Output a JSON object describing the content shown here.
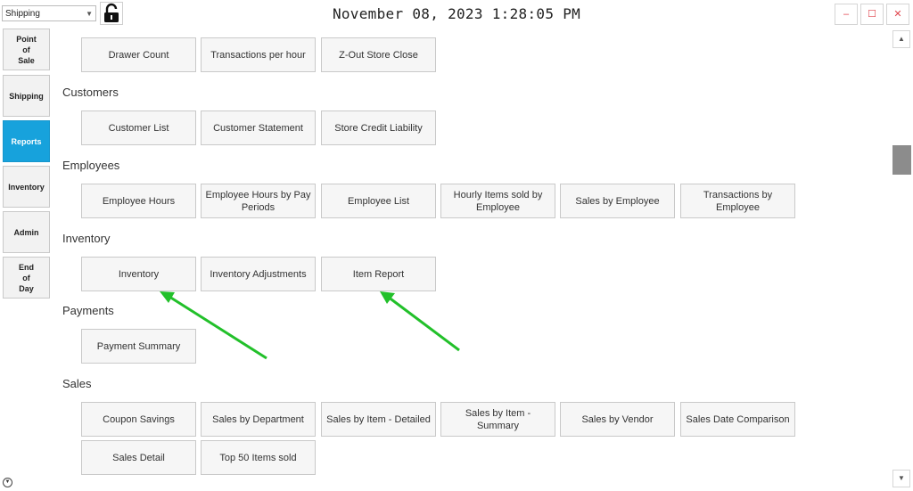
{
  "header": {
    "station_select_value": "Shipping",
    "datetime": "November 08, 2023 1:28:05 PM",
    "minimize": "–",
    "maximize": "☐",
    "close": "✕"
  },
  "nav": {
    "items": [
      {
        "label": "Point\nof\nSale"
      },
      {
        "label": "Shipping"
      },
      {
        "label": "Reports",
        "active": true
      },
      {
        "label": "Inventory"
      },
      {
        "label": "Admin"
      },
      {
        "label": "End\nof\nDay"
      }
    ]
  },
  "reports": {
    "top": {
      "drawer_count": "Drawer Count",
      "transactions_per_hour": "Transactions per hour",
      "z_out": "Z-Out Store Close"
    },
    "customers": {
      "title": "Customers",
      "customer_list": "Customer List",
      "customer_statement": "Customer Statement",
      "store_credit": "Store Credit Liability"
    },
    "employees": {
      "title": "Employees",
      "hours": "Employee Hours",
      "hours_by_pay": "Employee Hours by Pay Periods",
      "list": "Employee List",
      "hourly_items": "Hourly Items sold by Employee",
      "sales_by_employee": "Sales by Employee",
      "transactions_by_employee": "Transactions by Employee"
    },
    "inventory": {
      "title": "Inventory",
      "inventory": "Inventory",
      "adjustments": "Inventory Adjustments",
      "item_report": "Item Report"
    },
    "payments": {
      "title": "Payments",
      "summary": "Payment Summary"
    },
    "sales": {
      "title": "Sales",
      "coupon_savings": "Coupon Savings",
      "by_department": "Sales by Department",
      "by_item_detailed": "Sales by Item - Detailed",
      "by_item_summary": "Sales by Item - Summary",
      "by_vendor": "Sales by Vendor",
      "date_comparison": "Sales Date Comparison",
      "detail": "Sales Detail",
      "top50": "Top 50 Items sold"
    }
  },
  "colors": {
    "accent": "#17a2dc",
    "annotation_arrow": "#22c02a",
    "window_controls": "#e0454d"
  }
}
